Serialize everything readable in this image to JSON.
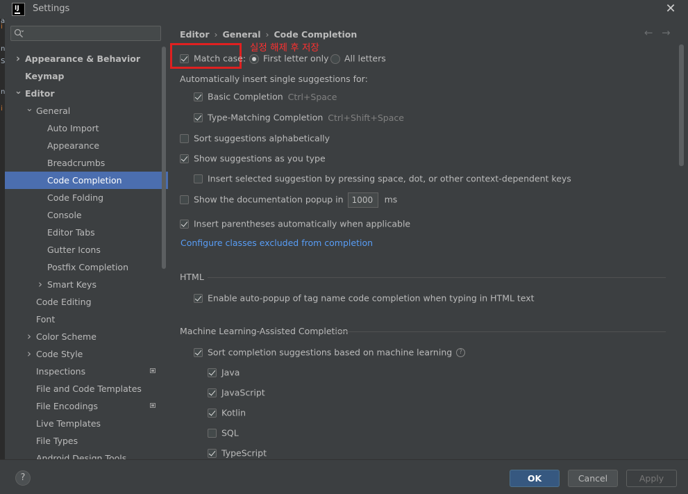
{
  "window": {
    "title": "Settings",
    "logo_text": "IJ"
  },
  "left_edge_chars": [
    "a",
    "i",
    "n",
    "S",
    "n",
    "i"
  ],
  "sidebar": {
    "search_placeholder": "",
    "items": [
      {
        "label": "Appearance & Behavior",
        "level": 0,
        "bold": true,
        "chevron": "right"
      },
      {
        "label": "Keymap",
        "level": 0,
        "bold": true,
        "chevron": ""
      },
      {
        "label": "Editor",
        "level": 0,
        "bold": true,
        "chevron": "down"
      },
      {
        "label": "General",
        "level": 1,
        "bold": false,
        "chevron": "down"
      },
      {
        "label": "Auto Import",
        "level": 2
      },
      {
        "label": "Appearance",
        "level": 2
      },
      {
        "label": "Breadcrumbs",
        "level": 2
      },
      {
        "label": "Code Completion",
        "level": 2,
        "selected": true
      },
      {
        "label": "Code Folding",
        "level": 2
      },
      {
        "label": "Console",
        "level": 2
      },
      {
        "label": "Editor Tabs",
        "level": 2
      },
      {
        "label": "Gutter Icons",
        "level": 2
      },
      {
        "label": "Postfix Completion",
        "level": 2
      },
      {
        "label": "Smart Keys",
        "level": 2,
        "chevron": "right"
      },
      {
        "label": "Code Editing",
        "level": 1
      },
      {
        "label": "Font",
        "level": 1
      },
      {
        "label": "Color Scheme",
        "level": 1,
        "chevron": "right"
      },
      {
        "label": "Code Style",
        "level": 1,
        "chevron": "right"
      },
      {
        "label": "Inspections",
        "level": 1,
        "badge": true
      },
      {
        "label": "File and Code Templates",
        "level": 1
      },
      {
        "label": "File Encodings",
        "level": 1,
        "badge": true
      },
      {
        "label": "Live Templates",
        "level": 1
      },
      {
        "label": "File Types",
        "level": 1
      },
      {
        "label": "Android Design Tools",
        "level": 1
      }
    ]
  },
  "breadcrumb": [
    "Editor",
    "General",
    "Code Completion"
  ],
  "nav": {
    "back": "←",
    "forward": "→"
  },
  "settings": {
    "match_case": {
      "label": "Match case:",
      "checked": true
    },
    "annotation": "실정 해제 후 저장",
    "radio_first_letter": {
      "label": "First letter only",
      "selected": true
    },
    "radio_all_letters": {
      "label": "All letters",
      "selected": false
    },
    "auto_insert_heading": "Automatically insert single suggestions for:",
    "basic_completion": {
      "label": "Basic Completion",
      "shortcut": "Ctrl+Space",
      "checked": true
    },
    "type_matching": {
      "label": "Type-Matching Completion",
      "shortcut": "Ctrl+Shift+Space",
      "checked": true
    },
    "sort_alpha": {
      "label": "Sort suggestions alphabetically",
      "checked": false
    },
    "show_as_you_type": {
      "label": "Show suggestions as you type",
      "checked": true
    },
    "insert_selected": {
      "label": "Insert selected suggestion by pressing space, dot, or other context-dependent keys",
      "checked": false
    },
    "doc_popup": {
      "label": "Show the documentation popup in",
      "value": "1000",
      "unit": "ms",
      "checked": false
    },
    "insert_parens": {
      "label": "Insert parentheses automatically when applicable",
      "checked": true
    },
    "config_link": "Configure classes excluded from completion",
    "html_section": "HTML",
    "html_autopopup": {
      "label": "Enable auto-popup of tag name code completion when typing in HTML text",
      "checked": true
    },
    "ml_section": "Machine Learning-Assisted Completion",
    "ml_sort": {
      "label": "Sort completion suggestions based on machine learning",
      "checked": true
    },
    "ml_langs": [
      {
        "label": "Java",
        "checked": true
      },
      {
        "label": "JavaScript",
        "checked": true
      },
      {
        "label": "Kotlin",
        "checked": true
      },
      {
        "label": "SQL",
        "checked": false
      },
      {
        "label": "TypeScript",
        "checked": true
      }
    ]
  },
  "buttons": {
    "help": "?",
    "ok": "OK",
    "cancel": "Cancel",
    "apply": "Apply"
  }
}
